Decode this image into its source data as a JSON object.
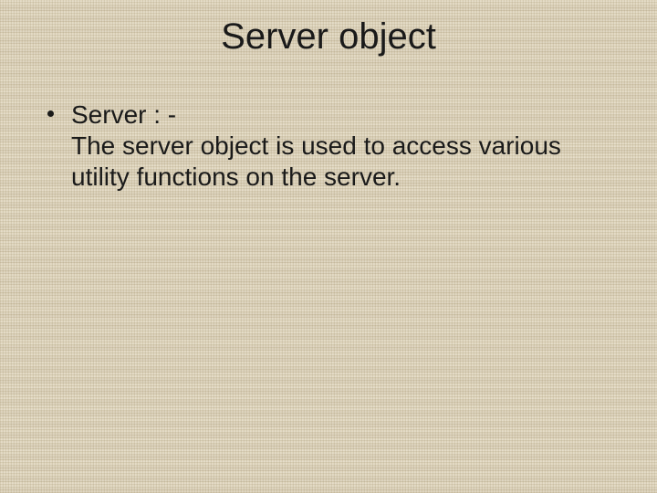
{
  "slide": {
    "title": "Server object",
    "bullets": [
      {
        "lead": "Server : -",
        "text": "The server object is used to access various utility functions on the server."
      }
    ]
  }
}
